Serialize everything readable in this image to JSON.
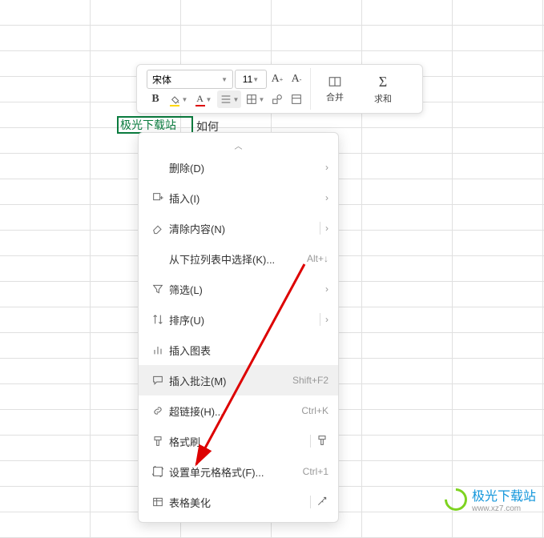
{
  "toolbar": {
    "font_name": "宋体",
    "font_size": "11",
    "bold": "B",
    "merge_label": "合并",
    "sum_label": "求和"
  },
  "cell": {
    "value": "极光下载站",
    "overflow": "如何"
  },
  "menu": {
    "delete": "删除(D)",
    "insert": "插入(I)",
    "clear": "清除内容(N)",
    "dropdown_select": "从下拉列表中选择(K)...",
    "dropdown_select_key": "Alt+↓",
    "filter": "筛选(L)",
    "sort": "排序(U)",
    "insert_chart": "插入图表",
    "insert_comment": "插入批注(M)",
    "insert_comment_key": "Shift+F2",
    "hyperlink": "超链接(H)...",
    "hyperlink_key": "Ctrl+K",
    "format_painter": "格式刷",
    "format_cells": "设置单元格格式(F)...",
    "format_cells_key": "Ctrl+1",
    "beautify": "表格美化"
  },
  "watermark": {
    "brand": "极光下载站",
    "url": "www.xz7.com"
  }
}
